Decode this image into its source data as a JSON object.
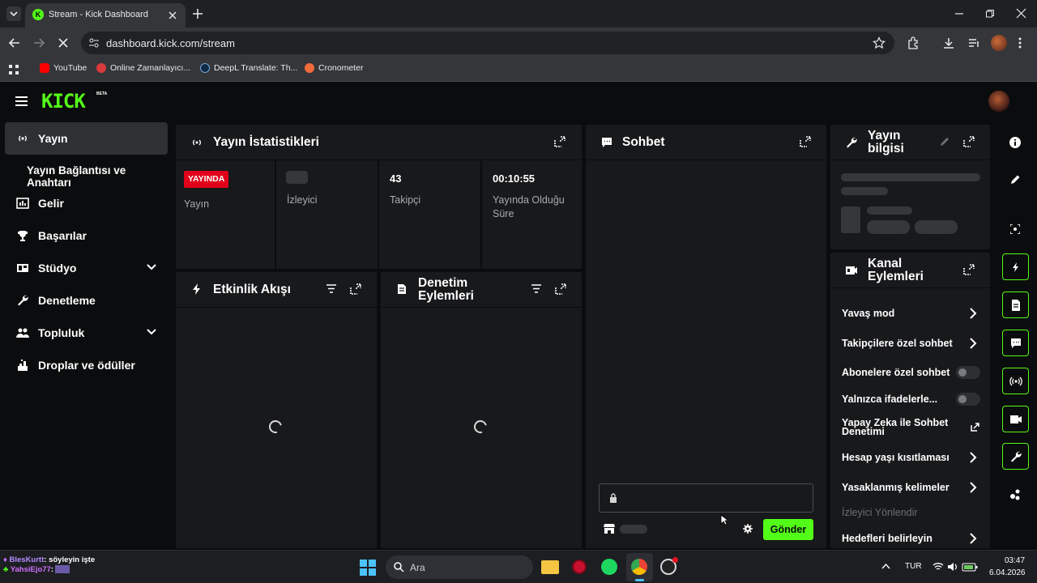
{
  "browser": {
    "tab_title": "Stream - Kick Dashboard",
    "url": "dashboard.kick.com/stream",
    "bookmarks": [
      {
        "label": "YouTube",
        "color": "#ff0000"
      },
      {
        "label": "Online Zamanlayıcı...",
        "color": "#d93b3b"
      },
      {
        "label": "DeepL Translate: Th...",
        "color": "#0f2b46"
      },
      {
        "label": "Cronometer",
        "color": "#f26b3a"
      }
    ]
  },
  "brand": {
    "logo": "KICK",
    "badge": "BETA",
    "accent": "#53fc18"
  },
  "sidebar": {
    "items": [
      {
        "label": "Yayın",
        "icon": "broadcast-icon"
      },
      {
        "label": "Yayın Bağlantısı ve Anahtarı",
        "icon": ""
      },
      {
        "label": "Gelir",
        "icon": "chart-icon"
      },
      {
        "label": "Başarılar",
        "icon": "trophy-icon"
      },
      {
        "label": "Stüdyo",
        "icon": "studio-icon"
      },
      {
        "label": "Denetleme",
        "icon": "wrench-icon"
      },
      {
        "label": "Topluluk",
        "icon": "community-icon"
      },
      {
        "label": "Droplar ve ödüller",
        "icon": "drops-icon"
      }
    ]
  },
  "stats": {
    "title": "Yayın İstatistikleri",
    "live_badge": "YAYINDA",
    "live_label": "Yayın",
    "viewers_label": "İzleyici",
    "followers_value": "43",
    "followers_label": "Takipçi",
    "duration_value": "00:10:55",
    "duration_label": "Yayında Olduğu Süre",
    "live_color": "#e2001a"
  },
  "activity": {
    "title": "Etkinlik Akışı"
  },
  "moderation": {
    "title": "Denetim Eylemleri"
  },
  "chat": {
    "title": "Sohbet",
    "send_label": "Gönder"
  },
  "stream_info": {
    "title": "Yayın bilgisi"
  },
  "channel_actions": {
    "title": "Kanal Eylemleri",
    "items": [
      {
        "label": "Yavaş mod",
        "control": "chevron"
      },
      {
        "label": "Takipçilere özel sohbet",
        "control": "chevron"
      },
      {
        "label": "Abonelere özel sohbet",
        "control": "toggle",
        "on": false
      },
      {
        "label": "Yalnızca ifadelerle...",
        "control": "toggle",
        "on": false
      },
      {
        "label": "Yapay Zeka ile Sohbet Denetimi",
        "control": "external"
      },
      {
        "label": "Hesap yaşı kısıtlaması",
        "control": "chevron"
      },
      {
        "label": "Yasaklanmış kelimeler",
        "control": "chevron"
      },
      {
        "label": "İzleyici Yönlendir",
        "control": "none",
        "disabled": true
      },
      {
        "label": "Hedefleri belirleyin",
        "control": "chevron"
      }
    ]
  },
  "overlay_chat": [
    {
      "user": "BlesKurtt",
      "text": ": söyleyin işte"
    },
    {
      "user": "YahsiEjo77",
      "text": ":"
    }
  ],
  "taskbar": {
    "search_placeholder": "Ara",
    "lang": "TUR",
    "time": "03:47",
    "date": "6.04.2026"
  }
}
